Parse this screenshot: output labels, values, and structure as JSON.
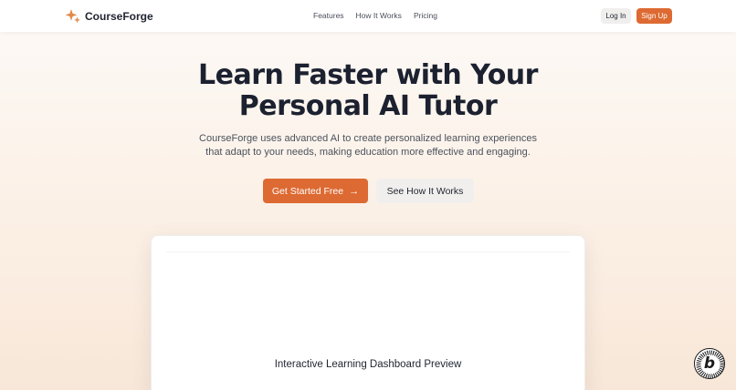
{
  "brand": {
    "name": "CourseForge",
    "accent": "#dd6a32"
  },
  "nav": {
    "links": [
      {
        "label": "Features"
      },
      {
        "label": "How It Works"
      },
      {
        "label": "Pricing"
      }
    ],
    "login_label": "Log In",
    "signup_label": "Sign Up"
  },
  "hero": {
    "title_line1": "Learn Faster with Your",
    "title_line2": "Personal AI Tutor",
    "subtitle_line1": "CourseForge uses advanced AI to create personalized learning experiences",
    "subtitle_line2": "that adapt to your needs, making education more effective and engaging.",
    "primary_cta": "Get Started Free",
    "secondary_cta": "See How It Works"
  },
  "preview": {
    "label": "Interactive Learning Dashboard Preview"
  },
  "badge": {
    "letter": "b",
    "ring_text": "POWERED BY BOLT.NEW · MADE IN BOLT.NEW ·"
  },
  "icons": {
    "brand": "sparkle-icon",
    "cta_arrow": "arrow-right-icon"
  }
}
